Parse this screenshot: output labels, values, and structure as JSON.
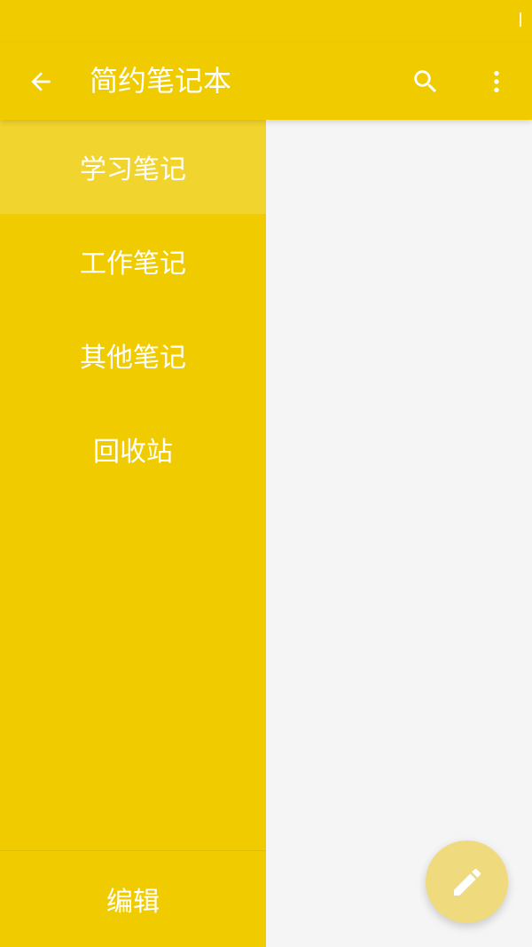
{
  "app": {
    "title": "简约笔记本"
  },
  "drawer": {
    "items": [
      {
        "label": "学习笔记",
        "active": true
      },
      {
        "label": "工作笔记",
        "active": false
      },
      {
        "label": "其他笔记",
        "active": false
      },
      {
        "label": "回收站",
        "active": false
      }
    ],
    "edit_label": "编辑"
  },
  "icons": {
    "back": "arrow-back-icon",
    "search": "search-icon",
    "more": "more-vert-icon",
    "fab": "pencil-icon"
  },
  "colors": {
    "primary": "#efcb00",
    "content_bg": "#f5f5f5",
    "fab_bg": "#efdb7e",
    "text": "#ffffff"
  }
}
